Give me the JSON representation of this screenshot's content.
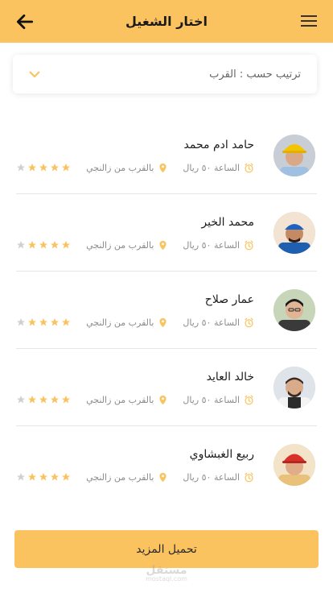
{
  "header": {
    "title": "اختار الشغيل",
    "back_icon": "arrow-left-icon",
    "menu_icon": "hamburger-menu-icon",
    "background": "#fbc35f"
  },
  "sort": {
    "label": "ترتيب حسب : القرب",
    "icon": "chevron-down-icon"
  },
  "workers": [
    {
      "name": "حامد ادم محمد",
      "rate": "الساعة ٥٠ ريال",
      "location": "بالقرب من زالنجي",
      "rating": 4,
      "max_rating": 5,
      "avatar": "worker-avatar-yellow-helmet"
    },
    {
      "name": "محمد الخير",
      "rate": "الساعة ٥٠ ريال",
      "location": "بالقرب من زالنجي",
      "rating": 4,
      "max_rating": 5,
      "avatar": "worker-avatar-blue-cap"
    },
    {
      "name": "عمار صلاح",
      "rate": "الساعة ٥٠ ريال",
      "location": "بالقرب من زالنجي",
      "rating": 4,
      "max_rating": 5,
      "avatar": "worker-avatar-green-shirt"
    },
    {
      "name": "خالد العايد",
      "rate": "الساعة ٥٠ ريال",
      "location": "بالقرب من زالنجي",
      "rating": 4,
      "max_rating": 5,
      "avatar": "worker-avatar-apron"
    },
    {
      "name": "ربيع الغبشاوي",
      "rate": "الساعة ٥٠ ريال",
      "location": "بالقرب من زالنجي",
      "rating": 4,
      "max_rating": 5,
      "avatar": "worker-avatar-red-helmet"
    }
  ],
  "load_more_label": "تحميل المزيد",
  "watermark": {
    "main": "مستقل",
    "sub": "mostaql.com"
  },
  "colors": {
    "accent": "#fbc35f",
    "star_on": "#fbc35f",
    "star_off": "#d0d0d0",
    "meta_text": "#8c8c8c"
  }
}
